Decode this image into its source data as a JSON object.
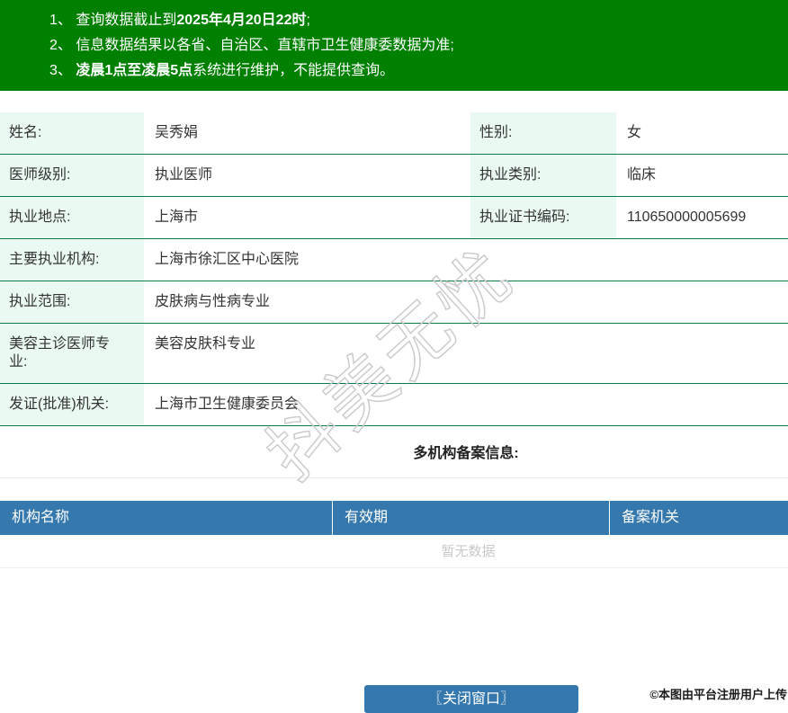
{
  "notice": {
    "items": [
      {
        "num": "1、",
        "pre": "查询数据截止到",
        "bold": "2025年4月20日22时",
        "post": ";"
      },
      {
        "num": "2、",
        "pre": "信息数据结果以各省、自治区、直辖市卫生健康委数据为准;",
        "bold": "",
        "post": ""
      },
      {
        "num": "3、",
        "pre": "",
        "bold": "凌晨1点至凌晨5点",
        "post": "系统进行维护，不能提供查询。"
      }
    ]
  },
  "profile": {
    "name_label": "姓名:",
    "name_value": "吴秀娟",
    "gender_label": "性别:",
    "gender_value": "女",
    "level_label": "医师级别:",
    "level_value": "执业医师",
    "category_label": "执业类别:",
    "category_value": "临床",
    "location_label": "执业地点:",
    "location_value": "上海市",
    "cert_label": "执业证书编码:",
    "cert_value": "110650000005699",
    "org_label": "主要执业机构:",
    "org_value": "上海市徐汇区中心医院",
    "scope_label": "执业范围:",
    "scope_value": "皮肤病与性病专业",
    "cosmetic_label": "美容主诊医师专业:",
    "cosmetic_value": "美容皮肤科专业",
    "issuer_label": "发证(批准)机关:",
    "issuer_value": "上海市卫生健康委员会"
  },
  "multi_org": {
    "title": "多机构备案信息:",
    "columns": [
      "机构名称",
      "有效期",
      "备案机关"
    ],
    "empty_text": "暂无数据"
  },
  "footer": {
    "close_button": "〖关闭窗口〗",
    "upload_note": "©本图由平台注册用户上传"
  },
  "watermark": {
    "text": "抖美无忧"
  },
  "colors": {
    "notice_bg": "#008000",
    "label_bg": "#eafaf2",
    "row_border": "#0a7a46",
    "table_header_bg": "#3578ad",
    "button_bg": "#3578ad",
    "empty_text_color": "#c9c9c9"
  }
}
